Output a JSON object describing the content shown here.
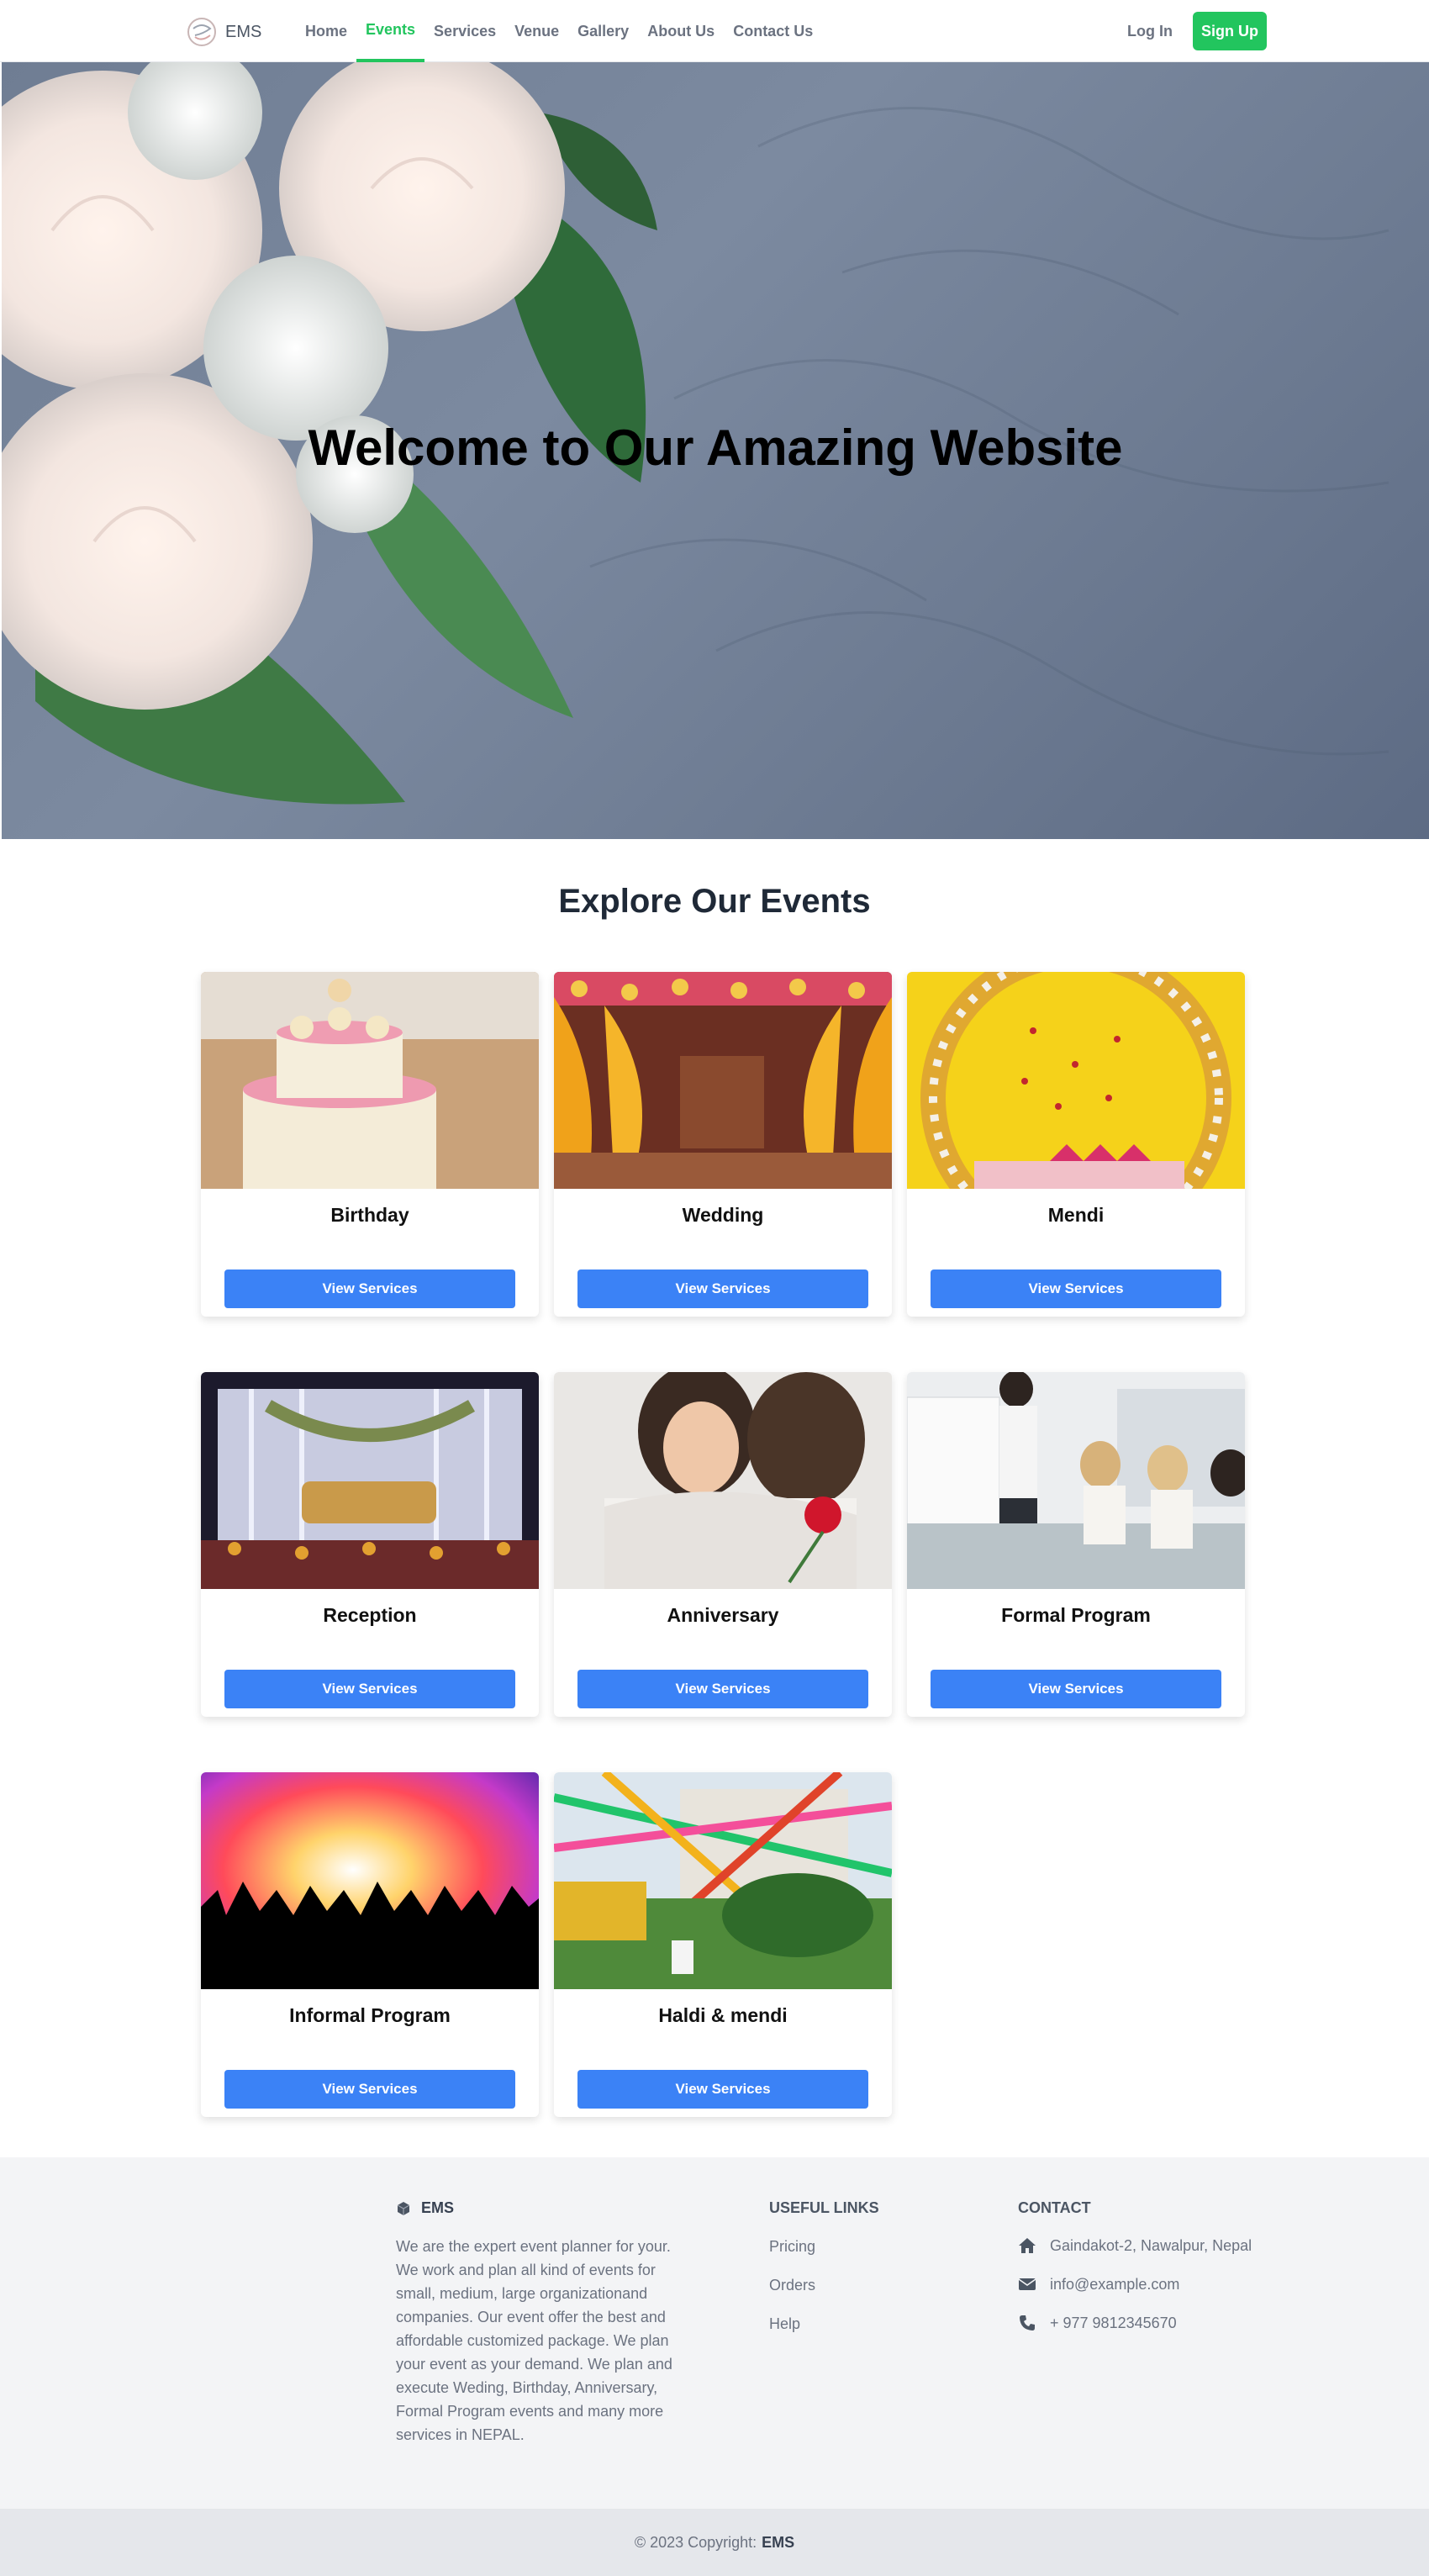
{
  "nav": {
    "brand": "EMS",
    "links": [
      "Home",
      "Events",
      "Services",
      "Venue",
      "Gallery",
      "About Us",
      "Contact Us"
    ],
    "active": "Events",
    "login": "Log In",
    "signup": "Sign Up"
  },
  "hero": {
    "title": "Welcome to Our Amazing Website"
  },
  "events": {
    "title": "Explore Our Events",
    "button_label": "View Services",
    "cards": [
      {
        "title": "Birthday",
        "image": "birthday-cake"
      },
      {
        "title": "Wedding",
        "image": "wedding-mandap"
      },
      {
        "title": "Mendi",
        "image": "mendi-floral-backdrop"
      },
      {
        "title": "Reception",
        "image": "reception-stage"
      },
      {
        "title": "Anniversary",
        "image": "couple-embrace-rose"
      },
      {
        "title": "Formal Program",
        "image": "business-meeting"
      },
      {
        "title": "Informal Program",
        "image": "concert-crowd"
      },
      {
        "title": "Haldi & mendi",
        "image": "haldi-garden-decor"
      }
    ]
  },
  "footer": {
    "brand": "EMS",
    "description": "We are the expert event planner for your. We work and plan all kind of events for small, medium, large organizationand companies. Our event offer the best and affordable customized package. We plan your event as your demand. We plan and execute Weding, Birthday, Anniversary, Formal Program events and many more services in NEPAL.",
    "useful_links_heading": "USEFUL LINKS",
    "useful_links": [
      "Pricing",
      "Orders",
      "Help"
    ],
    "contact_heading": "CONTACT",
    "contact": {
      "address": "Gaindakot-2, Nawalpur, Nepal",
      "email": "info@example.com",
      "phone": "+ 977 9812345670"
    },
    "copyright_prefix": "© 2023 Copyright:",
    "copyright_brand": "EMS"
  },
  "colors": {
    "accent_green": "#22c55e",
    "button_blue": "#3b82f6",
    "footer_bg": "#f3f4f6"
  }
}
